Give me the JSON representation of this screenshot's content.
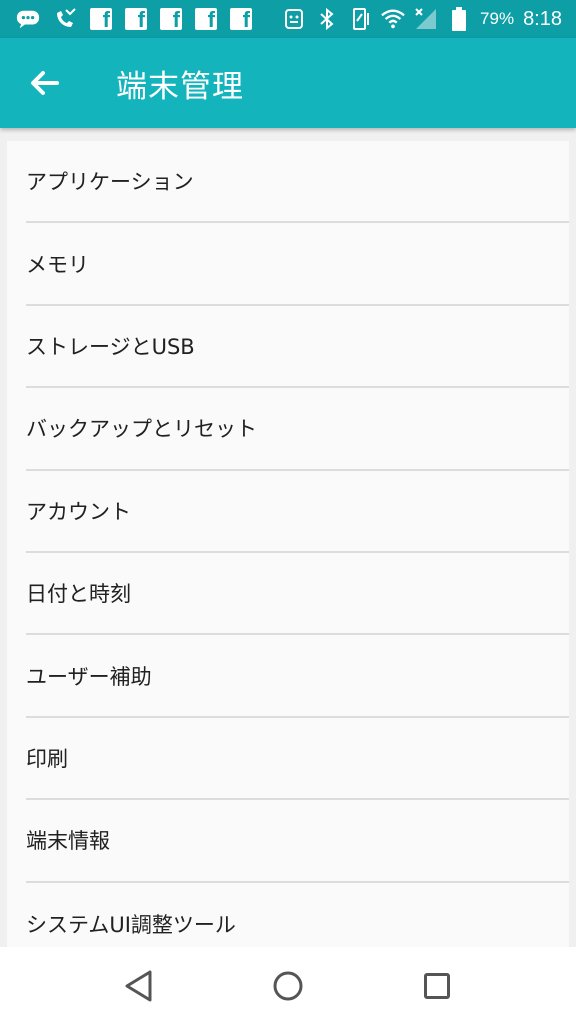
{
  "status_bar": {
    "battery_percent": "79%",
    "time": "8:18",
    "facebook_glyph": "f",
    "icons": [
      "message-icon",
      "missed-call-icon",
      "facebook-icon",
      "facebook-icon",
      "facebook-icon",
      "facebook-icon",
      "facebook-icon",
      "android-icon",
      "bluetooth-icon",
      "vibrate-icon",
      "wifi-icon",
      "signal-icon",
      "battery-icon"
    ]
  },
  "app_bar": {
    "title": "端末管理",
    "background": "#14b4bd"
  },
  "menu": {
    "items": [
      {
        "label": "アプリケーション"
      },
      {
        "label": "メモリ"
      },
      {
        "label": "ストレージとUSB"
      },
      {
        "label": "バックアップとリセット"
      },
      {
        "label": "アカウント"
      },
      {
        "label": "日付と時刻"
      },
      {
        "label": "ユーザー補助"
      },
      {
        "label": "印刷"
      },
      {
        "label": "端末情報"
      },
      {
        "label": "システムUI調整ツール"
      }
    ]
  },
  "nav_bar": {
    "buttons": [
      "back-icon",
      "home-icon",
      "recents-icon"
    ]
  }
}
